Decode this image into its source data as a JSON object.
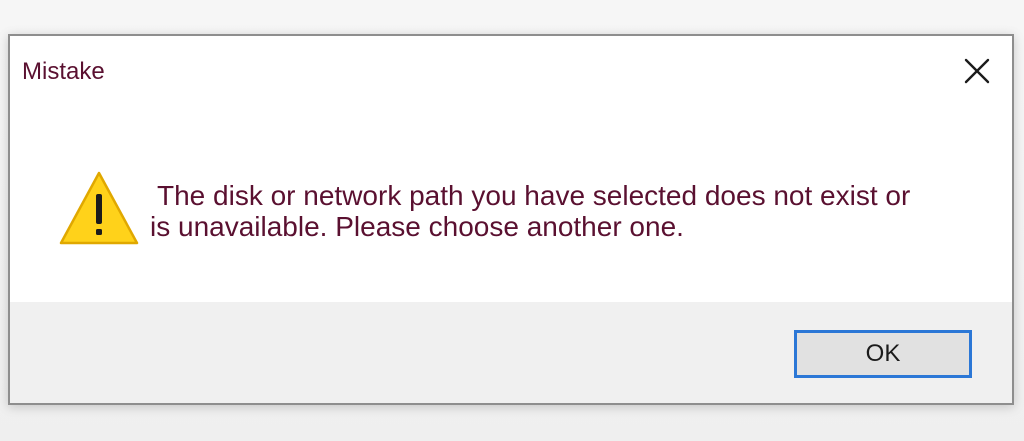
{
  "dialog": {
    "title": "Mistake",
    "close_icon": "close-icon",
    "icon": "warning-icon",
    "message_line1": "The disk or network path you have selected does not exist or",
    "message_line2": "is unavailable. Please choose another one.",
    "ok_label": "OK"
  },
  "colors": {
    "text": "#5a1030",
    "warning_fill": "#ffd21a",
    "warning_stroke": "#e0a800",
    "button_border": "#2b77d6",
    "footer_bg": "#f0f0f0"
  }
}
